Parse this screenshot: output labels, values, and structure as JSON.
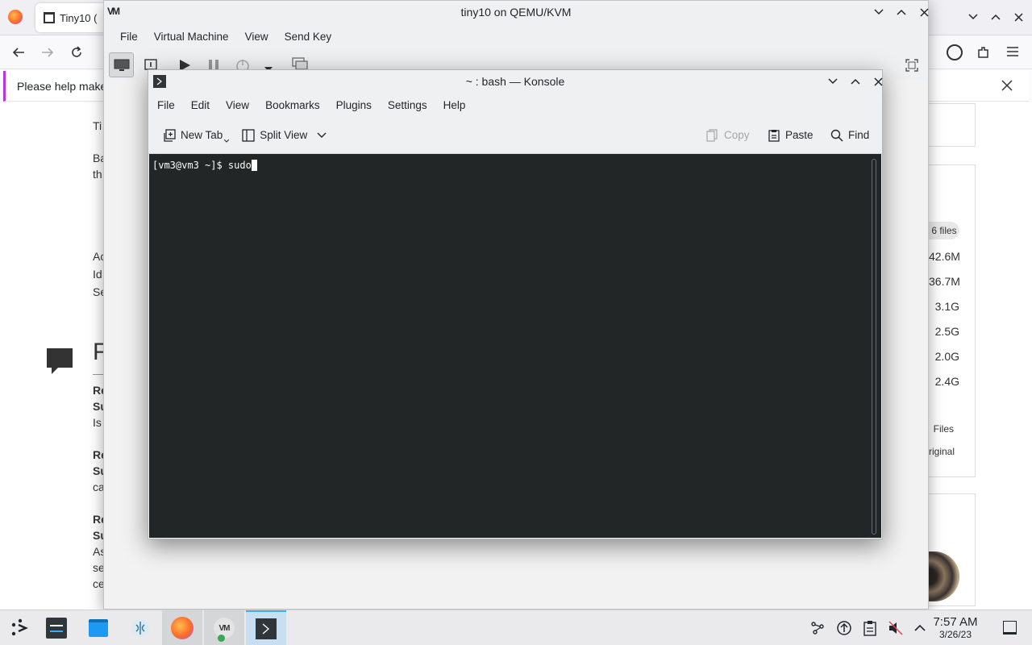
{
  "firefox": {
    "tab_title": "Tiny10 (",
    "notice_text": "Please help make",
    "left_fragments": [
      "Ti",
      "Ba",
      "th",
      "Ac",
      "Id",
      "Se",
      "Re",
      "Su",
      "Is",
      "Re",
      "Su",
      "ca",
      "Re",
      "Su",
      "As",
      "se",
      "ce"
    ],
    "section_heading": "F",
    "side_items": [
      "6 files",
      "42.6M",
      "36.7M",
      "3.1G",
      "2.5G",
      "2.0G",
      "2.4G",
      "Files",
      "riginal"
    ]
  },
  "vm": {
    "title": "tiny10 on QEMU/KVM",
    "menu": [
      "File",
      "Virtual Machine",
      "View",
      "Send Key"
    ]
  },
  "konsole": {
    "title": "~ : bash — Konsole",
    "menu": [
      "File",
      "Edit",
      "View",
      "Bookmarks",
      "Plugins",
      "Settings",
      "Help"
    ],
    "toolbar": {
      "new_tab": "New Tab",
      "split_view": "Split View",
      "copy": "Copy",
      "paste": "Paste",
      "find": "Find"
    },
    "prompt": "[vm3@vm3 ~]$ ",
    "command": "sudo"
  },
  "taskbar": {
    "time": "7:57 AM",
    "date": "3/26/23"
  },
  "colors": {
    "terminal_bg": "#232627",
    "accent": "#3daee9",
    "firefox_notice_accent": "#b833e1"
  }
}
